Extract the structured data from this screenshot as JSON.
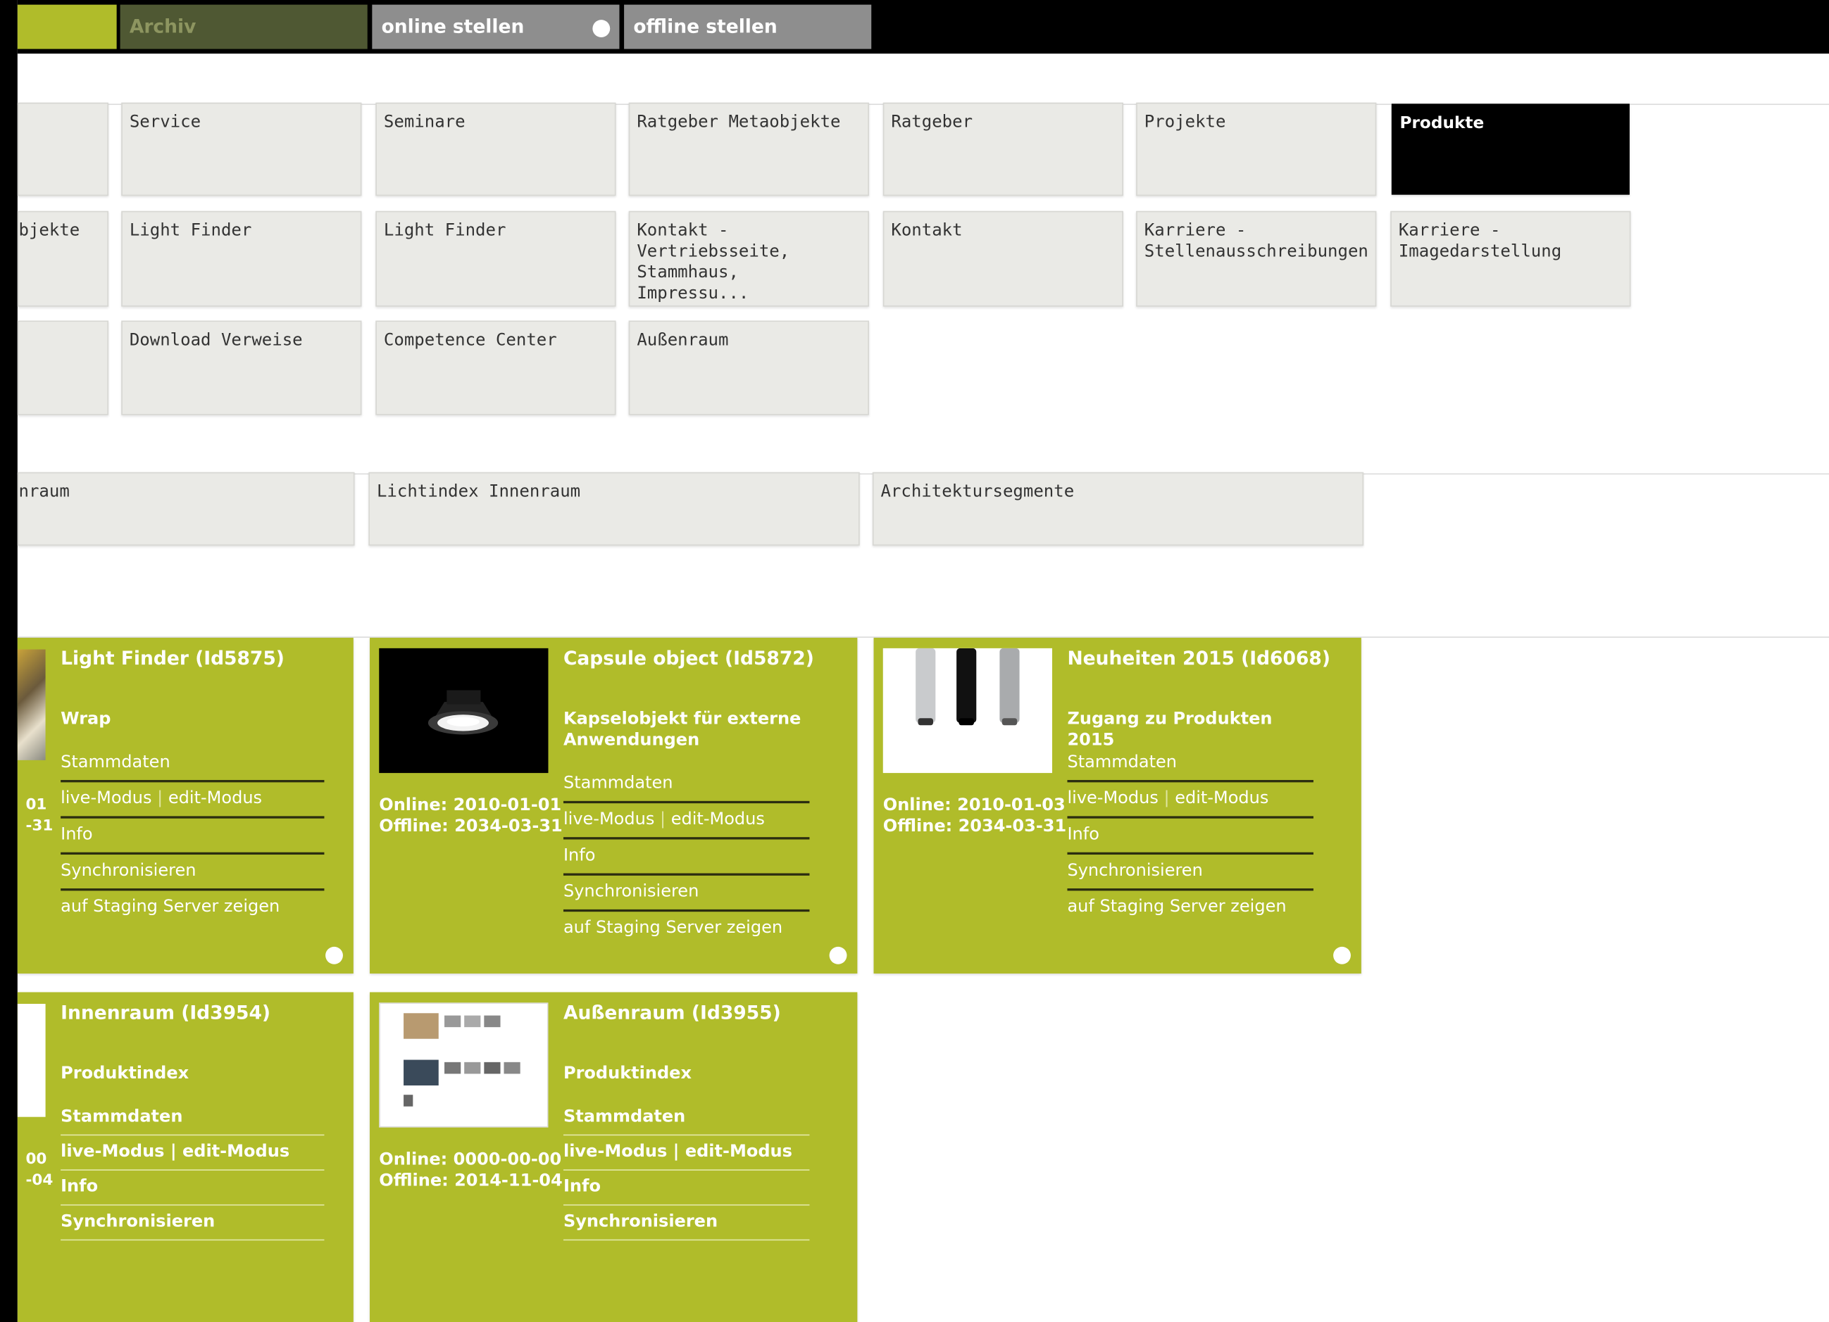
{
  "toolbar": {
    "archiv": "Archiv",
    "online": "online stellen",
    "offline": "offline stellen"
  },
  "tiles_row1": [
    "Service",
    "Seminare",
    "Ratgeber Metaobjekte",
    "Ratgeber",
    "Projekte",
    "Produkte"
  ],
  "tiles_row2": [
    "bjekte",
    "Light Finder",
    "Light Finder",
    "Kontakt - Vertriebsseite, Stammhaus, Impressu...",
    "Kontakt",
    "Karriere - Stellenausschreibungen",
    "Karriere - Imagedarstellung"
  ],
  "tiles_row3": [
    "Download Verweise",
    "Competence Center",
    "Außenraum"
  ],
  "tiles_row4": [
    "nraum",
    "Lichtindex Innenraum",
    "Architektursegmente"
  ],
  "cards": [
    {
      "title": "Light Finder (Id5875)",
      "subtitle": "Wrap",
      "links": [
        "Stammdaten",
        "live-Modus",
        "edit-Modus",
        "Info",
        "Synchronisieren",
        "auf Staging Server zeigen"
      ],
      "dates": [
        "01",
        "-31"
      ]
    },
    {
      "title": "Capsule object (Id5872)",
      "subtitle": "Kapselobjekt für externe Anwendungen",
      "links": [
        "Stammdaten",
        "live-Modus",
        "edit-Modus",
        "Info",
        "Synchronisieren",
        "auf Staging Server zeigen"
      ],
      "online": "Online: 2010-01-01",
      "offline": "Offline: 2034-03-31"
    },
    {
      "title": "Neuheiten 2015 (Id6068)",
      "subtitle": "Zugang zu Produkten 2015",
      "links": [
        "Stammdaten",
        "live-Modus",
        "edit-Modus",
        "Info",
        "Synchronisieren",
        "auf Staging Server zeigen"
      ],
      "online": "Online: 2010-01-03",
      "offline": "Offline: 2034-03-31"
    },
    {
      "title": "Innenraum (Id3954)",
      "subtitle": "Produktindex",
      "links": [
        "Stammdaten",
        "live-Modus | edit-Modus",
        "Info",
        "Synchronisieren"
      ],
      "dates": [
        "00",
        "-04"
      ]
    },
    {
      "title": "Außenraum (Id3955)",
      "subtitle": "Produktindex",
      "links": [
        "Stammdaten",
        "live-Modus | edit-Modus",
        "Info",
        "Synchronisieren"
      ],
      "online": "Online: 0000-00-00",
      "offline": "Offline: 2014-11-04"
    }
  ],
  "colors": {
    "accent": "#b0bc2a",
    "archiv_bg": "#4f5833",
    "button_gray": "#8e8e8e",
    "tile_bg": "#eaeae6",
    "active_tile": "#000000"
  }
}
